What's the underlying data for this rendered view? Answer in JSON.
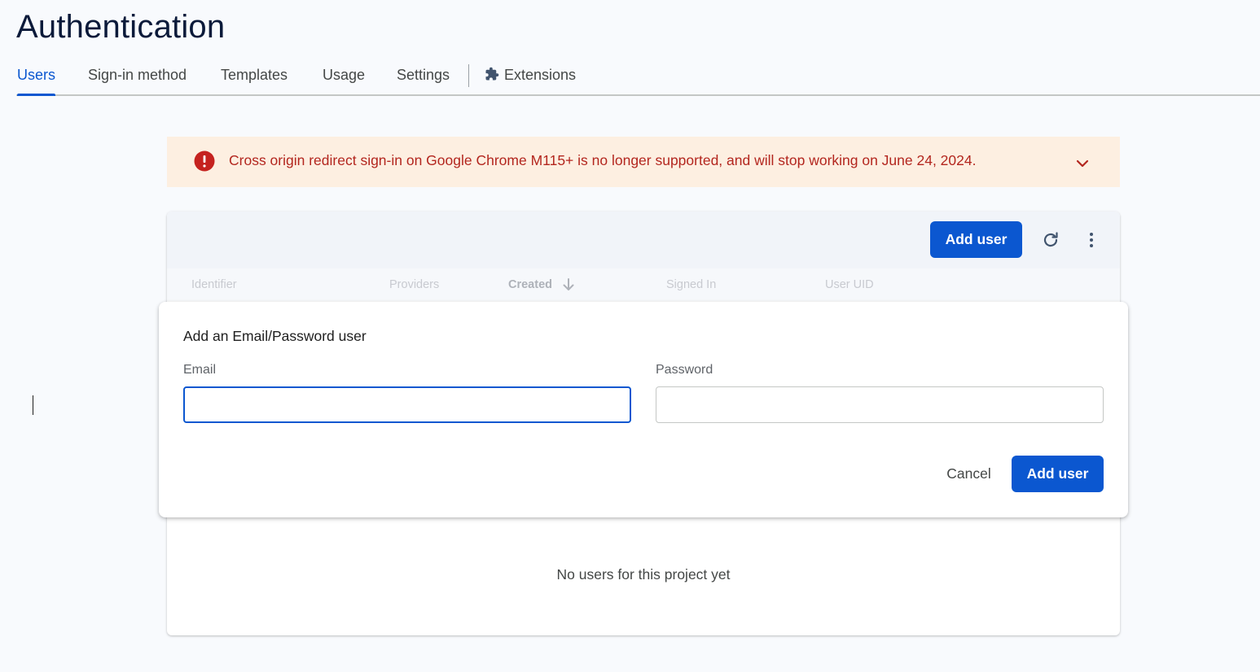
{
  "page": {
    "title": "Authentication"
  },
  "tabs": [
    {
      "label": "Users",
      "active": true
    },
    {
      "label": "Sign-in method"
    },
    {
      "label": "Templates"
    },
    {
      "label": "Usage"
    },
    {
      "label": "Settings"
    },
    {
      "label": "Extensions",
      "icon": "extensions-puzzle-icon"
    }
  ],
  "banner": {
    "icon": "error-icon",
    "text": "Cross origin redirect sign-in on Google Chrome M115+ is no longer supported, and will stop working on June 24, 2024.",
    "expand_icon": "chevron-down-icon",
    "color": "#b3261e",
    "background": "#fdefe1"
  },
  "users_table": {
    "add_user_label": "Add user",
    "refresh_icon": "refresh-icon",
    "more_icon": "more-vert-icon",
    "columns": [
      {
        "label": "Identifier"
      },
      {
        "label": "Providers"
      },
      {
        "label": "Created",
        "sorted": "descending"
      },
      {
        "label": "Signed In"
      },
      {
        "label": "User UID"
      }
    ],
    "empty_text": "No users for this project yet"
  },
  "dialog": {
    "title": "Add an Email/Password user",
    "email": {
      "label": "Email",
      "value": "",
      "focused": true
    },
    "password": {
      "label": "Password",
      "value": ""
    },
    "cancel_label": "Cancel",
    "add_label": "Add user"
  },
  "colors": {
    "accent": "#0b57d0",
    "page_bg": "#f8fafd"
  }
}
